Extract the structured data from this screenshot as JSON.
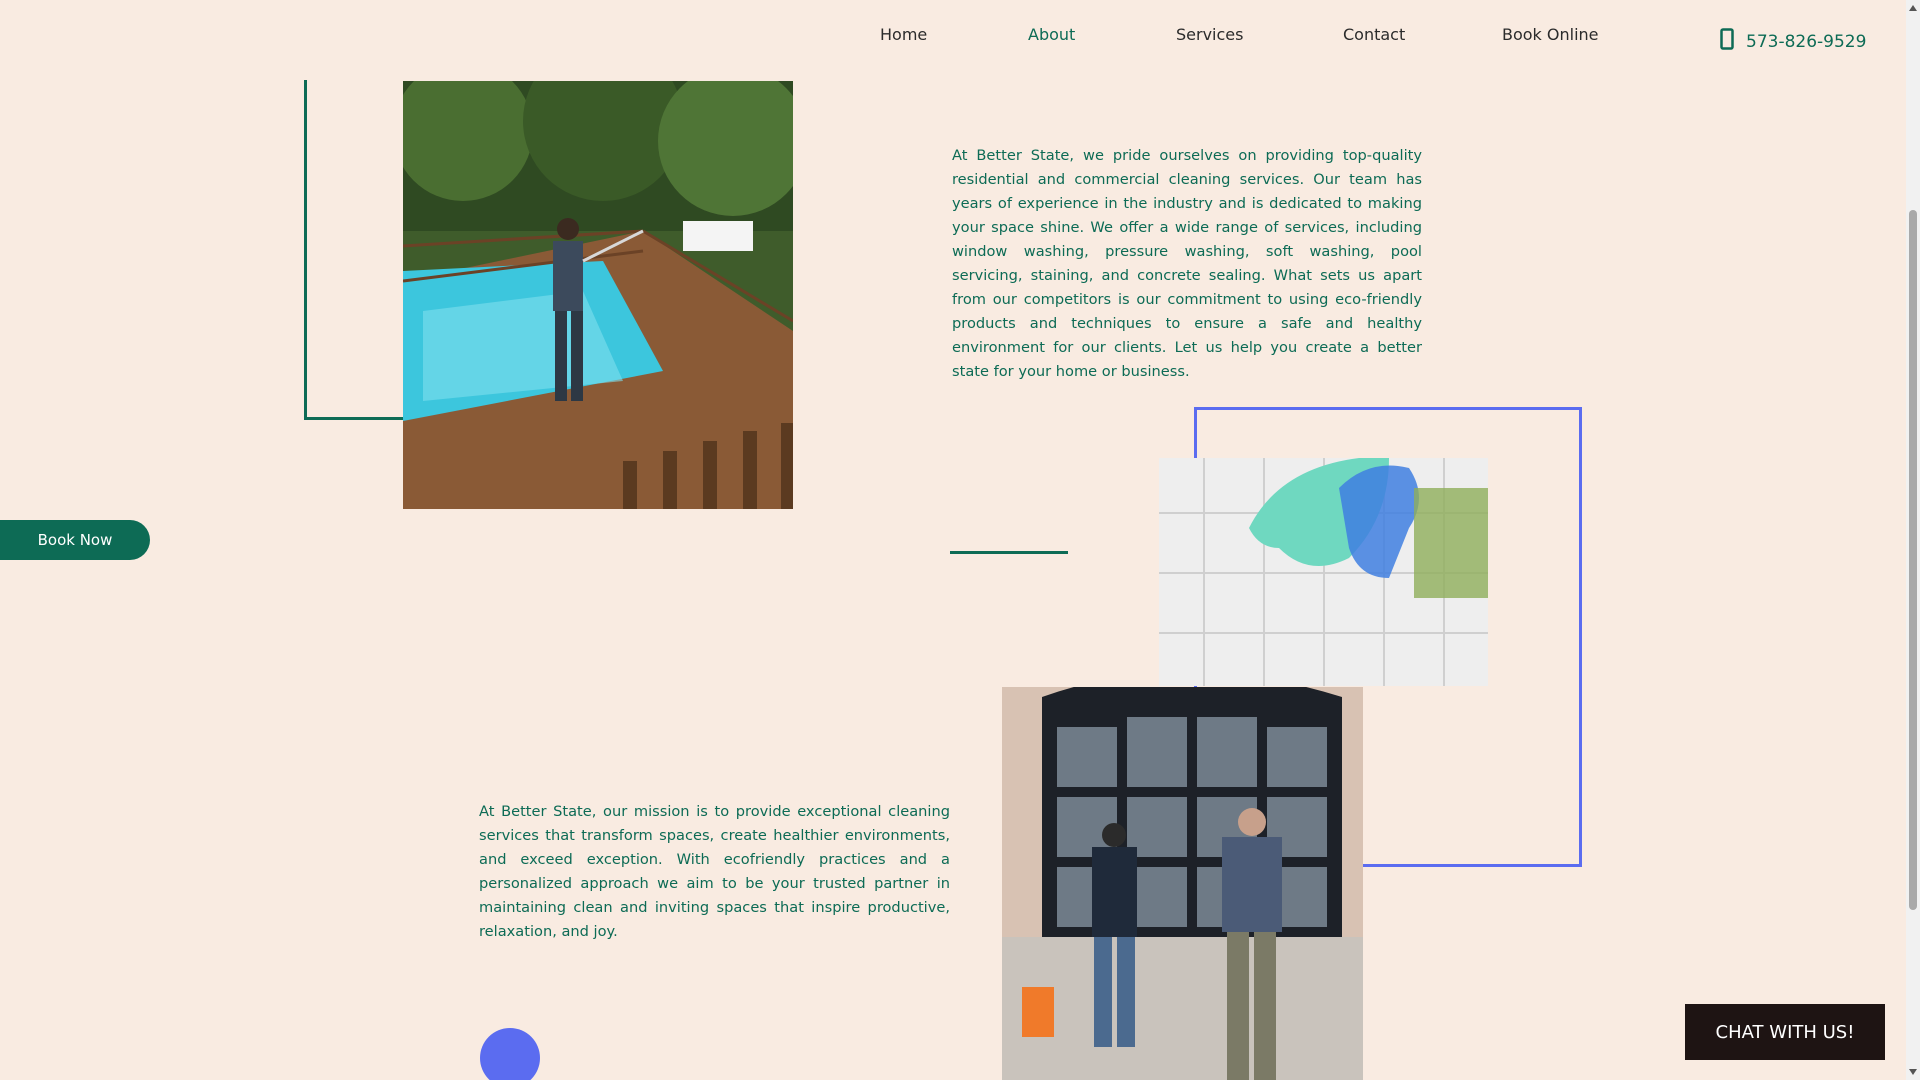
{
  "nav": {
    "items": [
      {
        "label": "Home",
        "active": false
      },
      {
        "label": "About",
        "active": true
      },
      {
        "label": "Services",
        "active": false
      },
      {
        "label": "Contact",
        "active": false
      },
      {
        "label": "Book Online",
        "active": false
      }
    ],
    "phone": "573-826-9529",
    "phone_icon": "smartphone-icon"
  },
  "about": {
    "paragraph": "At Better State, we pride ourselves on providing top-quality residential and commercial cleaning services. Our team has years of experience in the industry and is dedicated to making your space shine. We offer a wide range of services, including window washing, pressure washing, soft washing, pool servicing, staining, and concrete sealing. What sets us apart from our competitors is our commitment to using eco-friendly products and techniques to ensure a safe and healthy environment for our clients. Let us help you create a better state for your home or business."
  },
  "mission": {
    "paragraph": "At Better State, our mission is to provide exceptional cleaning services that transform spaces, create healthier environments, and exceed exception. With ecofriendly practices and a personalized approach we aim to be your trusted partner in maintaining clean and inviting spaces that inspire productive, relaxation, and joy."
  },
  "book_now": {
    "label": "Book Now"
  },
  "chat": {
    "label": "CHAT WITH US!"
  },
  "colors": {
    "background": "#f9ebe1",
    "brand_green": "#0d6b55",
    "accent_blue": "#5b6cf0",
    "chat_bg": "#1e1413"
  }
}
